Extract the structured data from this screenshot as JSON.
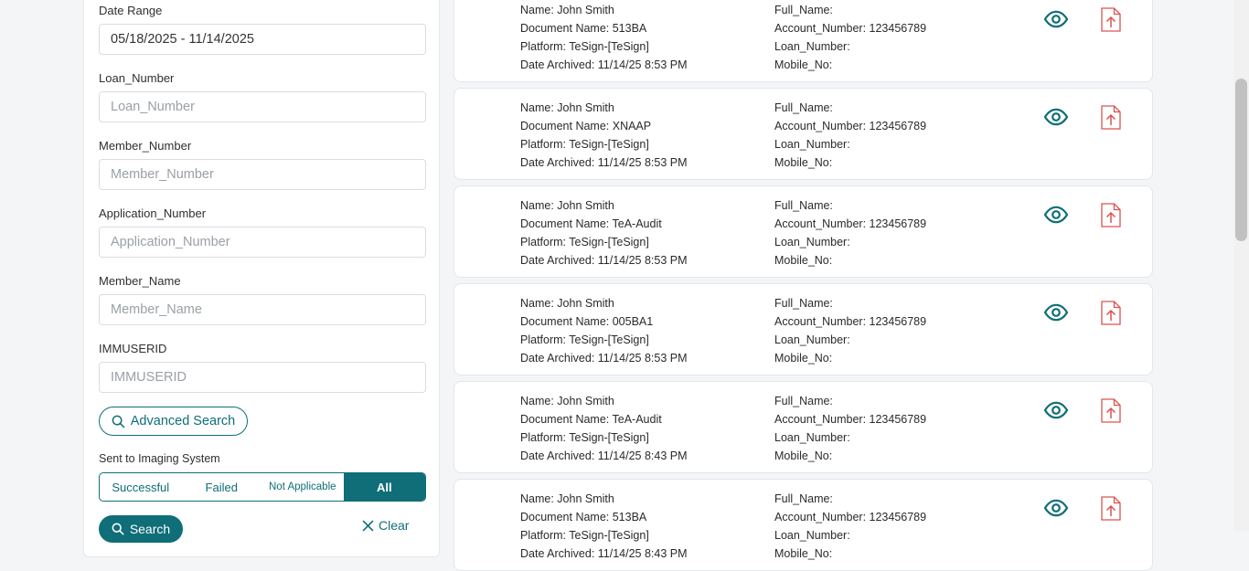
{
  "filters": {
    "date_range": {
      "label": "Date Range",
      "value": "05/18/2025 - 11/14/2025"
    },
    "loan_number": {
      "label": "Loan_Number",
      "placeholder": "Loan_Number"
    },
    "member_number": {
      "label": "Member_Number",
      "placeholder": "Member_Number"
    },
    "application_number": {
      "label": "Application_Number",
      "placeholder": "Application_Number"
    },
    "member_name": {
      "label": "Member_Name",
      "placeholder": "Member_Name"
    },
    "immuserid": {
      "label": "IMMUSERID",
      "placeholder": "IMMUSERID"
    },
    "advanced_search_label": "Advanced Search",
    "sent_to_imaging_label": "Sent to Imaging System",
    "segments": [
      "Successful",
      "Failed",
      "Not Applicable",
      "All"
    ],
    "selected_segment": "All",
    "search_label": "Search",
    "clear_label": "Clear"
  },
  "records": [
    {
      "name": "Name: John Smith",
      "document": "Document Name: 513BA",
      "platform": "Platform: TeSign-[TeSign]",
      "archived": "Date Archived: 11/14/25 8:53 PM",
      "full_name": "Full_Name:",
      "account": "Account_Number: 123456789",
      "loan": "Loan_Number:",
      "mobile": "Mobile_No:"
    },
    {
      "name": "Name: John Smith",
      "document": "Document Name: XNAAP",
      "platform": "Platform: TeSign-[TeSign]",
      "archived": "Date Archived: 11/14/25 8:53 PM",
      "full_name": "Full_Name:",
      "account": "Account_Number: 123456789",
      "loan": "Loan_Number:",
      "mobile": "Mobile_No:"
    },
    {
      "name": "Name: John Smith",
      "document": "Document Name: TeA-Audit",
      "platform": "Platform: TeSign-[TeSign]",
      "archived": "Date Archived: 11/14/25 8:53 PM",
      "full_name": "Full_Name:",
      "account": "Account_Number: 123456789",
      "loan": "Loan_Number:",
      "mobile": "Mobile_No:"
    },
    {
      "name": "Name: John Smith",
      "document": "Document Name: 005BA1",
      "platform": "Platform: TeSign-[TeSign]",
      "archived": "Date Archived: 11/14/25 8:53 PM",
      "full_name": "Full_Name:",
      "account": "Account_Number: 123456789",
      "loan": "Loan_Number:",
      "mobile": "Mobile_No:"
    },
    {
      "name": "Name: John Smith",
      "document": "Document Name: TeA-Audit",
      "platform": "Platform: TeSign-[TeSign]",
      "archived": "Date Archived: 11/14/25 8:43 PM",
      "full_name": "Full_Name:",
      "account": "Account_Number: 123456789",
      "loan": "Loan_Number:",
      "mobile": "Mobile_No:"
    },
    {
      "name": "Name: John Smith",
      "document": "Document Name: 513BA",
      "platform": "Platform: TeSign-[TeSign]",
      "archived": "Date Archived: 11/14/25 8:43 PM",
      "full_name": "Full_Name:",
      "account": "Account_Number: 123456789",
      "loan": "Loan_Number:",
      "mobile": "Mobile_No:"
    }
  ],
  "colors": {
    "accent": "#0f6e78",
    "pdf": "#d9534f"
  },
  "icons": {
    "view": "eye-icon",
    "pdf": "pdf-file-icon",
    "search": "search-icon",
    "clear": "close-icon"
  }
}
